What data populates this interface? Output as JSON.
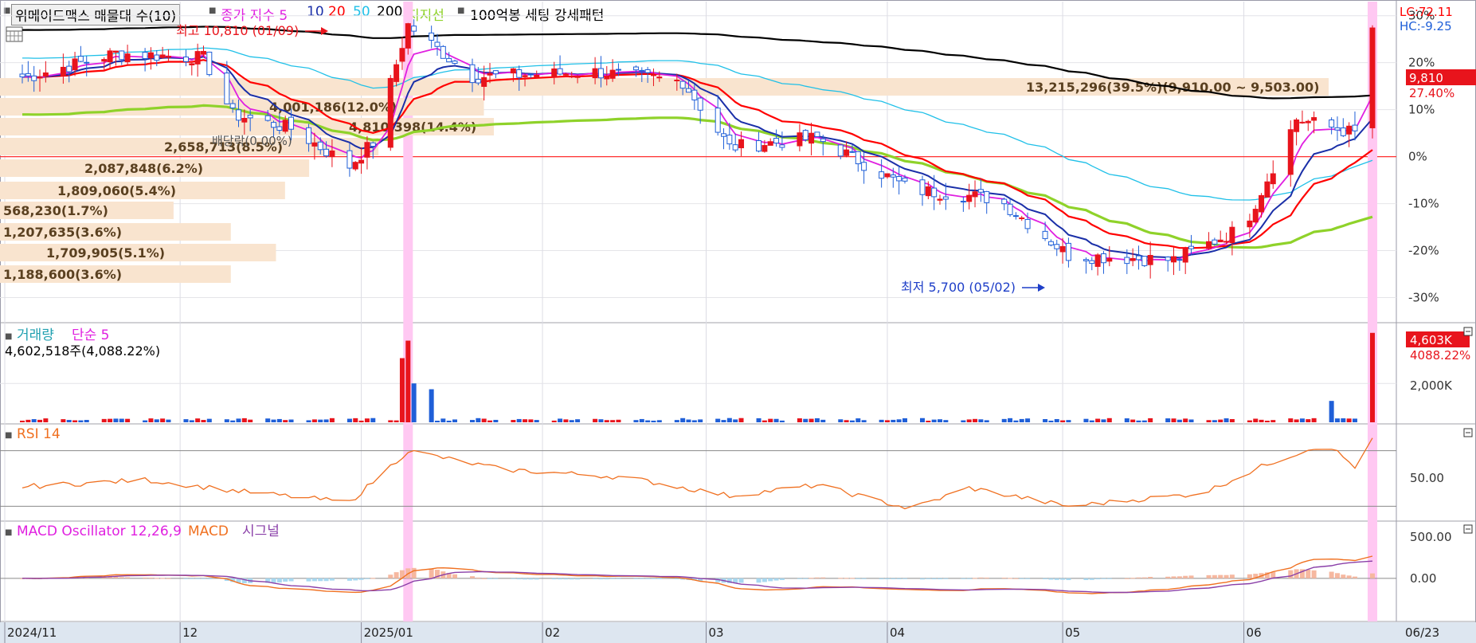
{
  "header": {
    "stock_label": "위메이드맥스 매물대 수(10)",
    "ma_label": "종가 지수 5",
    "ma10": "10",
    "ma20": "20",
    "ma50": "50",
    "ma200": "200",
    "support_label": "지지선",
    "setting_label": "100억봉 세팅 강세패턴",
    "lc": "LC:72.11",
    "hc": "HC:-9.25"
  },
  "colors": {
    "ma5": "#e020e0",
    "ma10": "#1a2fa8",
    "ma20": "#ff0000",
    "ma50": "#20c0e8",
    "ma200": "#000000",
    "support": "#8fd22a",
    "up": "#e8141c",
    "down": "#1f5fd8",
    "highlight": "#ffc8f2",
    "volume_band": "#f9e4cf"
  },
  "annotations": {
    "high": "최고 10,810 (01/09)",
    "low": "최저 5,700 (05/02)",
    "current_price": "9,810",
    "current_pct": "27.40%",
    "dividend": "배당락(0.00%)"
  },
  "chart_data": [
    {
      "type": "candlestick",
      "title": "위메이드맥스",
      "ylabel_ticks": [
        "30%",
        "20%",
        "10%",
        "0%",
        "-10%",
        "-20%",
        "-30%"
      ],
      "y_tick_values": [
        30,
        20,
        10,
        0,
        -10,
        -20,
        -30
      ],
      "ylim": [
        -35,
        33
      ],
      "x_labels": [
        "2024/11",
        "12",
        "2025/01",
        "02",
        "03",
        "04",
        "05",
        "06",
        "06/23"
      ],
      "close_pct_samples": [
        {
          "date": "2024-11-05",
          "pct": 17
        },
        {
          "date": "2024-11-20",
          "pct": 22
        },
        {
          "date": "2024-12-05",
          "pct": 21
        },
        {
          "date": "2024-12-10",
          "pct": 9
        },
        {
          "date": "2024-12-20",
          "pct": 6
        },
        {
          "date": "2024-12-30",
          "pct": -2
        },
        {
          "date": "2025-01-03",
          "pct": 3
        },
        {
          "date": "2025-01-09",
          "pct": 28
        },
        {
          "date": "2025-01-20",
          "pct": 17
        },
        {
          "date": "2025-02-10",
          "pct": 18
        },
        {
          "date": "2025-02-25",
          "pct": 16
        },
        {
          "date": "2025-03-05",
          "pct": 2
        },
        {
          "date": "2025-03-20",
          "pct": 4
        },
        {
          "date": "2025-04-05",
          "pct": -7
        },
        {
          "date": "2025-04-20",
          "pct": -9
        },
        {
          "date": "2025-05-02",
          "pct": -21
        },
        {
          "date": "2025-05-20",
          "pct": -22
        },
        {
          "date": "2025-06-01",
          "pct": -15
        },
        {
          "date": "2025-06-10",
          "pct": 8
        },
        {
          "date": "2025-06-20",
          "pct": 5
        },
        {
          "date": "2025-06-23",
          "pct": 27.4
        }
      ],
      "volume_profile": [
        {
          "label": "13,215,296(39.5%)(9,910.00 ~ 9,503.00)",
          "pct": 39.5
        },
        {
          "label": "4,001,186(12.0%)",
          "pct": 12.0
        },
        {
          "label": "4,810,398(14.4%)",
          "pct": 14.4
        },
        {
          "label": "2,658,713(8.5%)",
          "pct": 8.5
        },
        {
          "label": "2,087,848(6.2%)",
          "pct": 6.2
        },
        {
          "label": "1,809,060(5.4%)",
          "pct": 5.4
        },
        {
          "label": "568,230(1.7%)",
          "pct": 1.7
        },
        {
          "label": "1,207,635(3.6%)",
          "pct": 3.6
        },
        {
          "label": "1,709,905(5.1%)",
          "pct": 5.1
        },
        {
          "label": "1,188,600(3.6%)",
          "pct": 3.6
        }
      ]
    },
    {
      "type": "bar",
      "title": "거래량",
      "ma_label": "단순 5",
      "summary": "4,602,518주(4,088.22%)",
      "current_label": "4,603K",
      "current_pct": "4088.22%",
      "y_tick": "2,000K",
      "y_tick_value": 2000,
      "ylim": [
        0,
        5000
      ]
    },
    {
      "type": "line",
      "title": "RSI 14",
      "y_tick": "50.00",
      "y_tick_value": 50,
      "upper": 72.11,
      "lower": 30,
      "ylim": [
        20,
        90
      ],
      "samples": [
        {
          "date": "2024-11-05",
          "v": 45
        },
        {
          "date": "2024-11-25",
          "v": 50
        },
        {
          "date": "2024-12-10",
          "v": 42
        },
        {
          "date": "2024-12-30",
          "v": 33
        },
        {
          "date": "2025-01-09",
          "v": 72
        },
        {
          "date": "2025-01-25",
          "v": 58
        },
        {
          "date": "2025-02-15",
          "v": 52
        },
        {
          "date": "2025-03-05",
          "v": 38
        },
        {
          "date": "2025-03-20",
          "v": 46
        },
        {
          "date": "2025-04-05",
          "v": 28
        },
        {
          "date": "2025-04-15",
          "v": 44
        },
        {
          "date": "2025-05-02",
          "v": 30
        },
        {
          "date": "2025-05-25",
          "v": 40
        },
        {
          "date": "2025-06-05",
          "v": 62
        },
        {
          "date": "2025-06-15",
          "v": 78
        },
        {
          "date": "2025-06-20",
          "v": 60
        },
        {
          "date": "2025-06-23",
          "v": 80
        }
      ]
    },
    {
      "type": "line",
      "title": "MACD Oscillator 12,26,9",
      "series": [
        {
          "name": "MACD"
        },
        {
          "name": "시그널"
        }
      ],
      "y_ticks": [
        "500.00",
        "0.00"
      ],
      "y_tick_values": [
        500,
        0
      ],
      "ylim": [
        -500,
        650
      ]
    }
  ]
}
